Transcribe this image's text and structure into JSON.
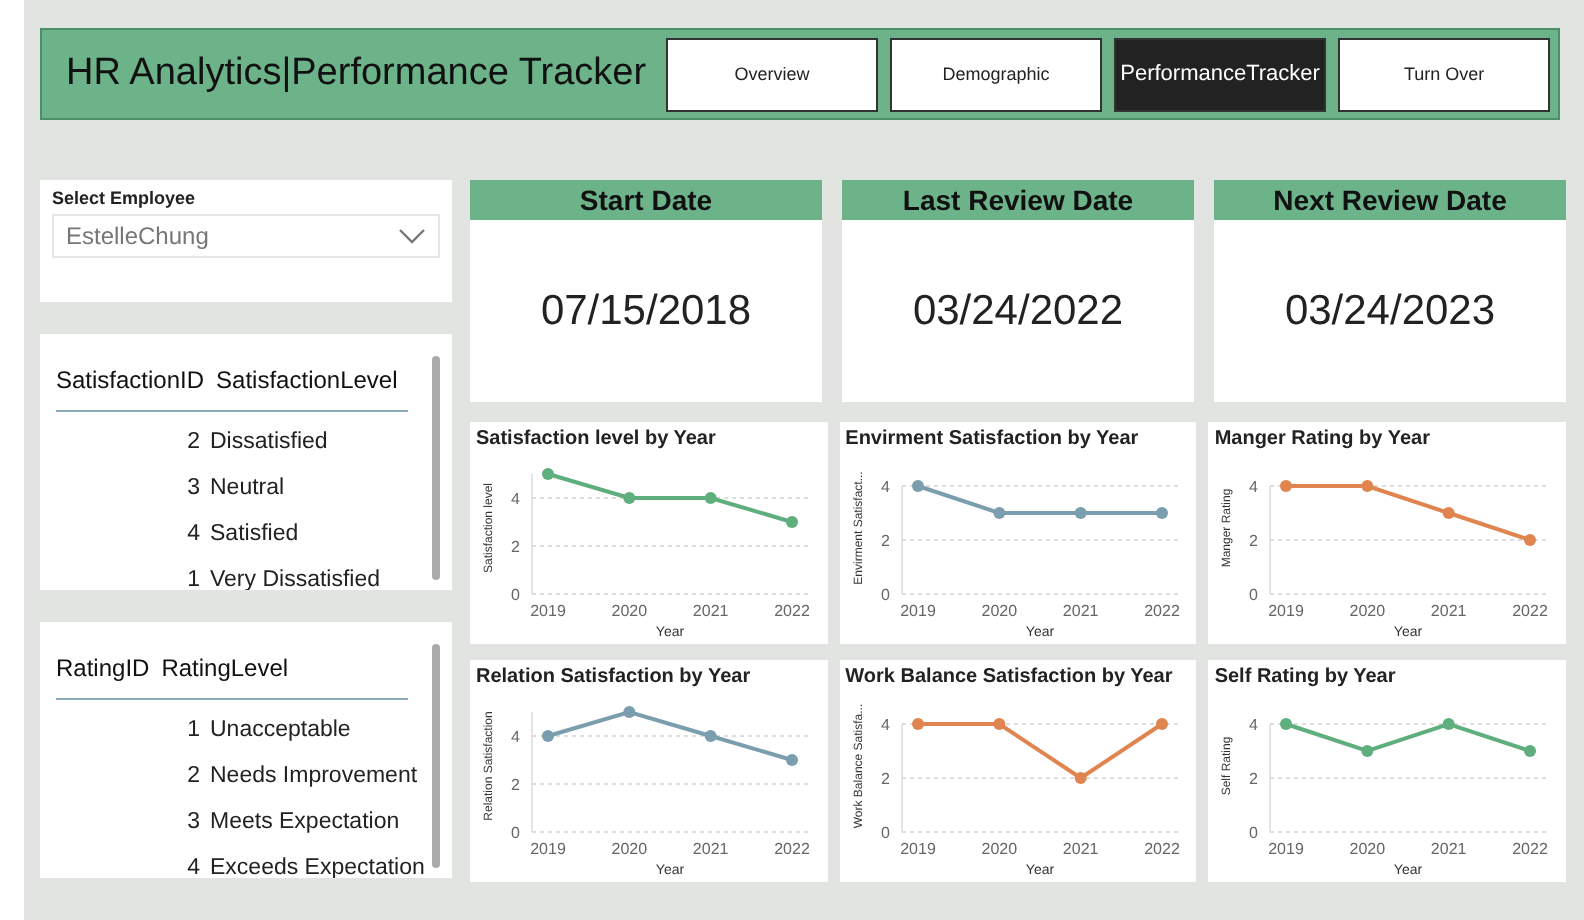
{
  "header": {
    "title": "HR Analytics|Performance Tracker",
    "nav": [
      {
        "label": "Overview",
        "selected": false
      },
      {
        "label": "Demographic",
        "selected": false
      },
      {
        "label": "PerformanceTracker",
        "selected": true
      },
      {
        "label": "Turn Over",
        "selected": false
      }
    ]
  },
  "employee_filter": {
    "label": "Select Employee",
    "value": "EstelleChung"
  },
  "tables": [
    {
      "columns": [
        "SatisfactionID",
        "SatisfactionLevel"
      ],
      "rows": [
        [
          "2",
          "Dissatisfied"
        ],
        [
          "3",
          "Neutral"
        ],
        [
          "4",
          "Satisfied"
        ],
        [
          "1",
          "Very Dissatisfied"
        ]
      ]
    },
    {
      "columns": [
        "RatingID",
        "RatingLevel"
      ],
      "rows": [
        [
          "1",
          "Unacceptable"
        ],
        [
          "2",
          "Needs Improvement"
        ],
        [
          "3",
          "Meets Expectation"
        ],
        [
          "4",
          "Exceeds Expectation"
        ]
      ]
    }
  ],
  "date_cards": [
    {
      "title": "Start Date",
      "value": "07/15/2018"
    },
    {
      "title": "Last Review Date",
      "value": "03/24/2022"
    },
    {
      "title": "Next Review Date",
      "value": "03/24/2023"
    }
  ],
  "charts": [
    {
      "chart_data": {
        "type": "line",
        "title": "Satisfaction level by Year",
        "xlabel": "Year",
        "ylabel": "Satisfaction level",
        "categories": [
          "2019",
          "2020",
          "2021",
          "2022"
        ],
        "series": [
          {
            "color": "#5fae7e",
            "marker": "circle",
            "values": [
              5,
              4,
              4,
              3
            ]
          }
        ],
        "ylim": [
          0,
          5
        ],
        "yticks": [
          0,
          2,
          4
        ]
      }
    },
    {
      "chart_data": {
        "type": "line",
        "title": "Envirment Satisfaction by Year",
        "xlabel": "Year",
        "ylabel": "Envirment Satisfact...",
        "categories": [
          "2019",
          "2020",
          "2021",
          "2022"
        ],
        "series": [
          {
            "color": "#7b9eae",
            "marker": "circle",
            "values": [
              4,
              3,
              3,
              3
            ]
          }
        ],
        "ylim": [
          0,
          4
        ],
        "yticks": [
          0,
          2,
          4
        ]
      }
    },
    {
      "chart_data": {
        "type": "line",
        "title": "Manger Rating by Year",
        "xlabel": "Year",
        "ylabel": "Manger Rating",
        "categories": [
          "2019",
          "2020",
          "2021",
          "2022"
        ],
        "series": [
          {
            "color": "#e0854f",
            "marker": "circle",
            "values": [
              4,
              4,
              3,
              2
            ]
          }
        ],
        "ylim": [
          0,
          4
        ],
        "yticks": [
          0,
          2,
          4
        ]
      }
    },
    {
      "chart_data": {
        "type": "line",
        "title": "Relation Satisfaction by Year",
        "xlabel": "Year",
        "ylabel": "Relation Satisfaction",
        "categories": [
          "2019",
          "2020",
          "2021",
          "2022"
        ],
        "series": [
          {
            "color": "#7b9eae",
            "marker": "circle",
            "values": [
              4,
              5,
              4,
              3
            ]
          }
        ],
        "ylim": [
          0,
          5
        ],
        "yticks": [
          0,
          2,
          4
        ]
      }
    },
    {
      "chart_data": {
        "type": "line",
        "title": "Work Balance Satisfaction by Year",
        "xlabel": "Year",
        "ylabel": "Work Balance Satisfa...",
        "categories": [
          "2019",
          "2020",
          "2021",
          "2022"
        ],
        "series": [
          {
            "color": "#e0854f",
            "marker": "circle",
            "values": [
              4,
              4,
              2,
              4
            ]
          }
        ],
        "ylim": [
          0,
          4
        ],
        "yticks": [
          0,
          2,
          4
        ]
      }
    },
    {
      "chart_data": {
        "type": "line",
        "title": "Self Rating by Year",
        "xlabel": "Year",
        "ylabel": "Self Rating",
        "categories": [
          "2019",
          "2020",
          "2021",
          "2022"
        ],
        "series": [
          {
            "color": "#5fae7e",
            "marker": "circle",
            "values": [
              4,
              3,
              4,
              3
            ]
          }
        ],
        "ylim": [
          0,
          4
        ],
        "yticks": [
          0,
          2,
          4
        ]
      }
    }
  ]
}
